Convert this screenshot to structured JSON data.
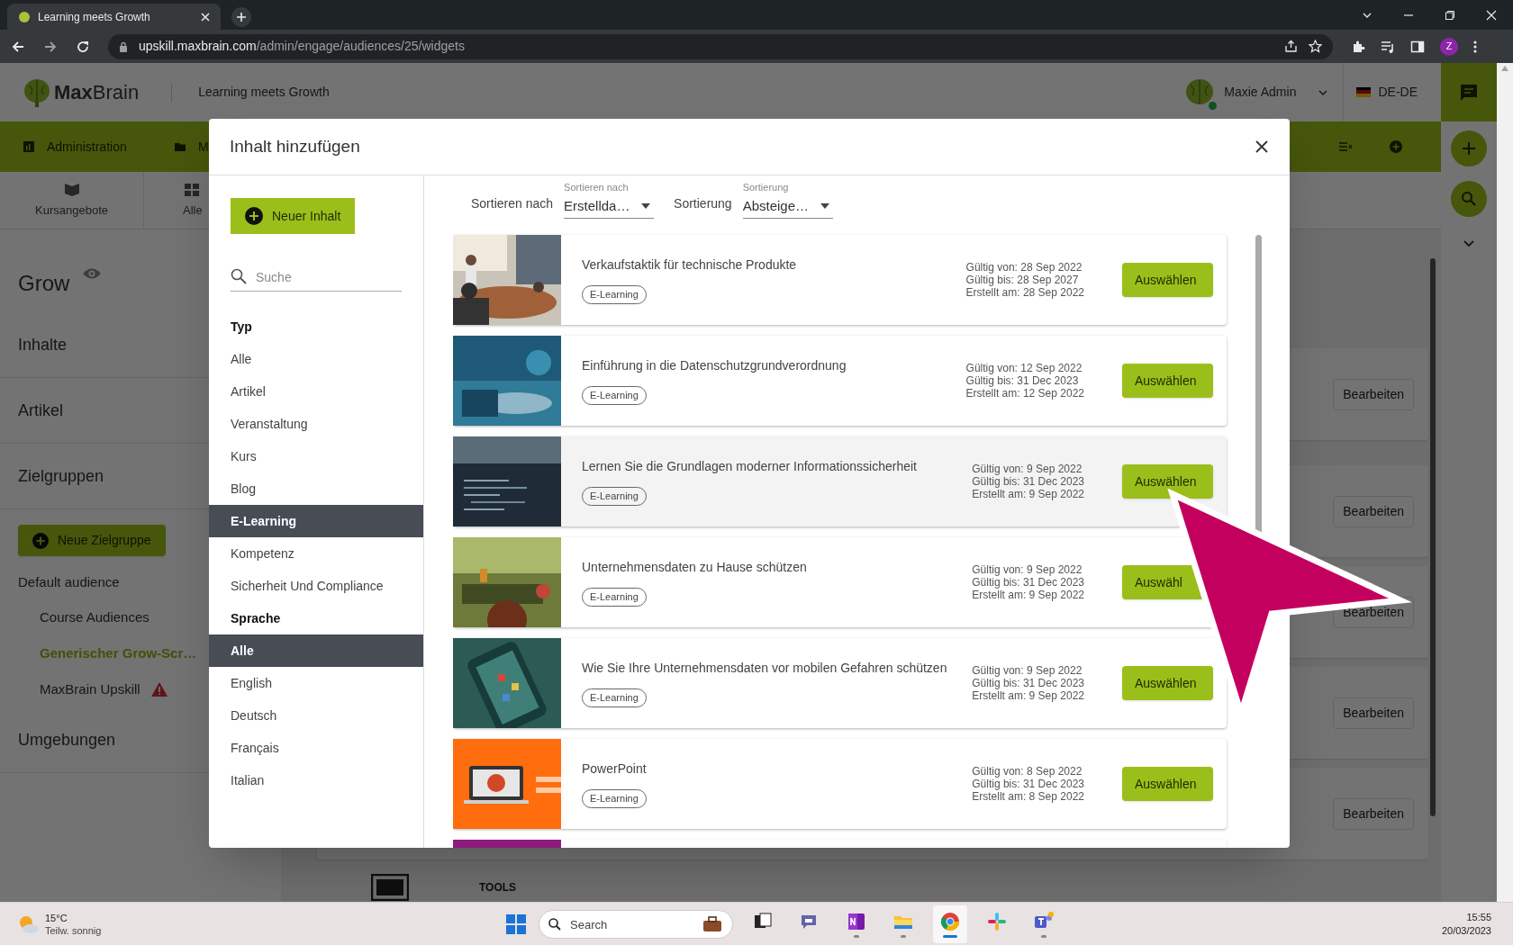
{
  "browser": {
    "tab_title": "Learning meets Growth",
    "url_host": "upskill.maxbrain.com",
    "url_path": "/admin/engage/audiences/25/widgets",
    "profile_initial": "Z"
  },
  "header": {
    "brand": "**Max**Brain",
    "tagline": "Learning meets Growth",
    "user": "Maxie Admin",
    "user_online": true,
    "locale": "DE-DE"
  },
  "nav": [
    {
      "label": "Administration"
    },
    {
      "label": "M"
    }
  ],
  "subnav": [
    {
      "label": "Kursangebote"
    },
    {
      "label": "Alle"
    }
  ],
  "sidebar": {
    "title": "Grow",
    "items": [
      {
        "kind": "section",
        "label": "Inhalte"
      },
      {
        "kind": "section",
        "label": "Artikel"
      },
      {
        "kind": "section",
        "label": "Zielgruppen"
      },
      {
        "kind": "button",
        "label": "Neue Zielgruppe"
      },
      {
        "kind": "group",
        "label": "Default audience",
        "children": [
          {
            "label": "Course Audiences",
            "selected": false,
            "warning": false
          },
          {
            "label": "Generischer Grow-Scr…",
            "selected": true,
            "warning": false
          },
          {
            "label": "MaxBrain Upskill",
            "selected": false,
            "warning": true
          }
        ]
      },
      {
        "kind": "section",
        "label": "Umgebungen"
      }
    ]
  },
  "content": {
    "edit_buttons": [
      "Bearbeiten",
      "Bearbeiten",
      "Bearbeiten",
      "Bearbeiten",
      "Bearbeiten"
    ],
    "tools_label": "TOOLS"
  },
  "dialog": {
    "title": "Inhalt hinzufügen",
    "new_button": "Neuer Inhalt",
    "search": {
      "placeholder": "Suche"
    },
    "filters": [
      {
        "heading": "Typ",
        "options": [
          {
            "label": "Alle",
            "selected": false
          },
          {
            "label": "Artikel",
            "selected": false
          },
          {
            "label": "Veranstaltung",
            "selected": false
          },
          {
            "label": "Kurs",
            "selected": false
          },
          {
            "label": "Blog",
            "selected": false
          },
          {
            "label": "E-Learning",
            "selected": true
          },
          {
            "label": "Kompetenz",
            "selected": false
          },
          {
            "label": "Sicherheit Und Compliance",
            "selected": false
          }
        ]
      },
      {
        "heading": "Sprache",
        "options": [
          {
            "label": "Alle",
            "selected": true
          },
          {
            "label": "English",
            "selected": false
          },
          {
            "label": "Deutsch",
            "selected": false
          },
          {
            "label": "Français",
            "selected": false
          },
          {
            "label": "Italian",
            "selected": false
          }
        ]
      }
    ],
    "sort": [
      {
        "prefix": "Sortieren nach",
        "label": "Sortieren nach",
        "value": "Erstellda…"
      },
      {
        "prefix": "Sortierung",
        "label": "Sortierung",
        "value": "Absteige…"
      }
    ],
    "items": [
      {
        "title": "Verkaufstaktik für technische Produkte",
        "tag": "E-Learning",
        "dates": [
          "Gültig von: 28 Sep 2022",
          "Gültig bis: 28 Sep 2027",
          "Erstellt am: 28 Sep 2022"
        ],
        "button": "Auswählen",
        "hovered": false
      },
      {
        "title": "Einführung in die Datenschutzgrundverordnung",
        "tag": "E-Learning",
        "dates": [
          "Gültig von: 12 Sep 2022",
          "Gültig bis: 31 Dec 2023",
          "Erstellt am: 12 Sep 2022"
        ],
        "button": "Auswählen",
        "hovered": false
      },
      {
        "title": "Lernen Sie die Grundlagen moderner Informationssicherheit",
        "tag": "E-Learning",
        "dates": [
          "Gültig von: 9 Sep 2022",
          "Gültig bis: 31 Dec 2023",
          "Erstellt am: 9 Sep 2022"
        ],
        "button": "Auswählen",
        "hovered": true
      },
      {
        "title": "Unternehmensdaten zu Hause schützen",
        "tag": "E-Learning",
        "dates": [
          "Gültig von: 9 Sep 2022",
          "Gültig bis: 31 Dec 2023",
          "Erstellt am: 9 Sep 2022"
        ],
        "button": "Auswähl",
        "hovered": false
      },
      {
        "title": "Wie Sie Ihre Unternehmensdaten vor mobilen Gefahren schützen",
        "tag": "E-Learning",
        "dates": [
          "Gültig von: 9 Sep 2022",
          "Gültig bis: 31 Dec 2023",
          "Erstellt am: 9 Sep 2022"
        ],
        "button": "Auswählen",
        "hovered": false
      },
      {
        "title": "PowerPoint",
        "tag": "E-Learning",
        "dates": [
          "Gültig von: 8 Sep 2022",
          "Gültig bis: 31 Dec 2023",
          "Erstellt am: 8 Sep 2022"
        ],
        "button": "Auswählen",
        "hovered": false
      }
    ]
  },
  "taskbar": {
    "weather_temp": "15°C",
    "weather_text": "Teilw. sonnig",
    "search_placeholder": "Search",
    "time": "15:55",
    "date": "20/03/2023",
    "apps": [
      {
        "kind": "taskview",
        "running": false,
        "active": false
      },
      {
        "kind": "chat",
        "running": false,
        "active": false
      },
      {
        "kind": "notes",
        "running": true,
        "active": false
      },
      {
        "kind": "folder",
        "running": true,
        "active": false
      },
      {
        "kind": "browser",
        "running": true,
        "active": true
      },
      {
        "kind": "slack",
        "running": false,
        "active": false
      },
      {
        "kind": "teams",
        "running": true,
        "active": false
      }
    ]
  }
}
